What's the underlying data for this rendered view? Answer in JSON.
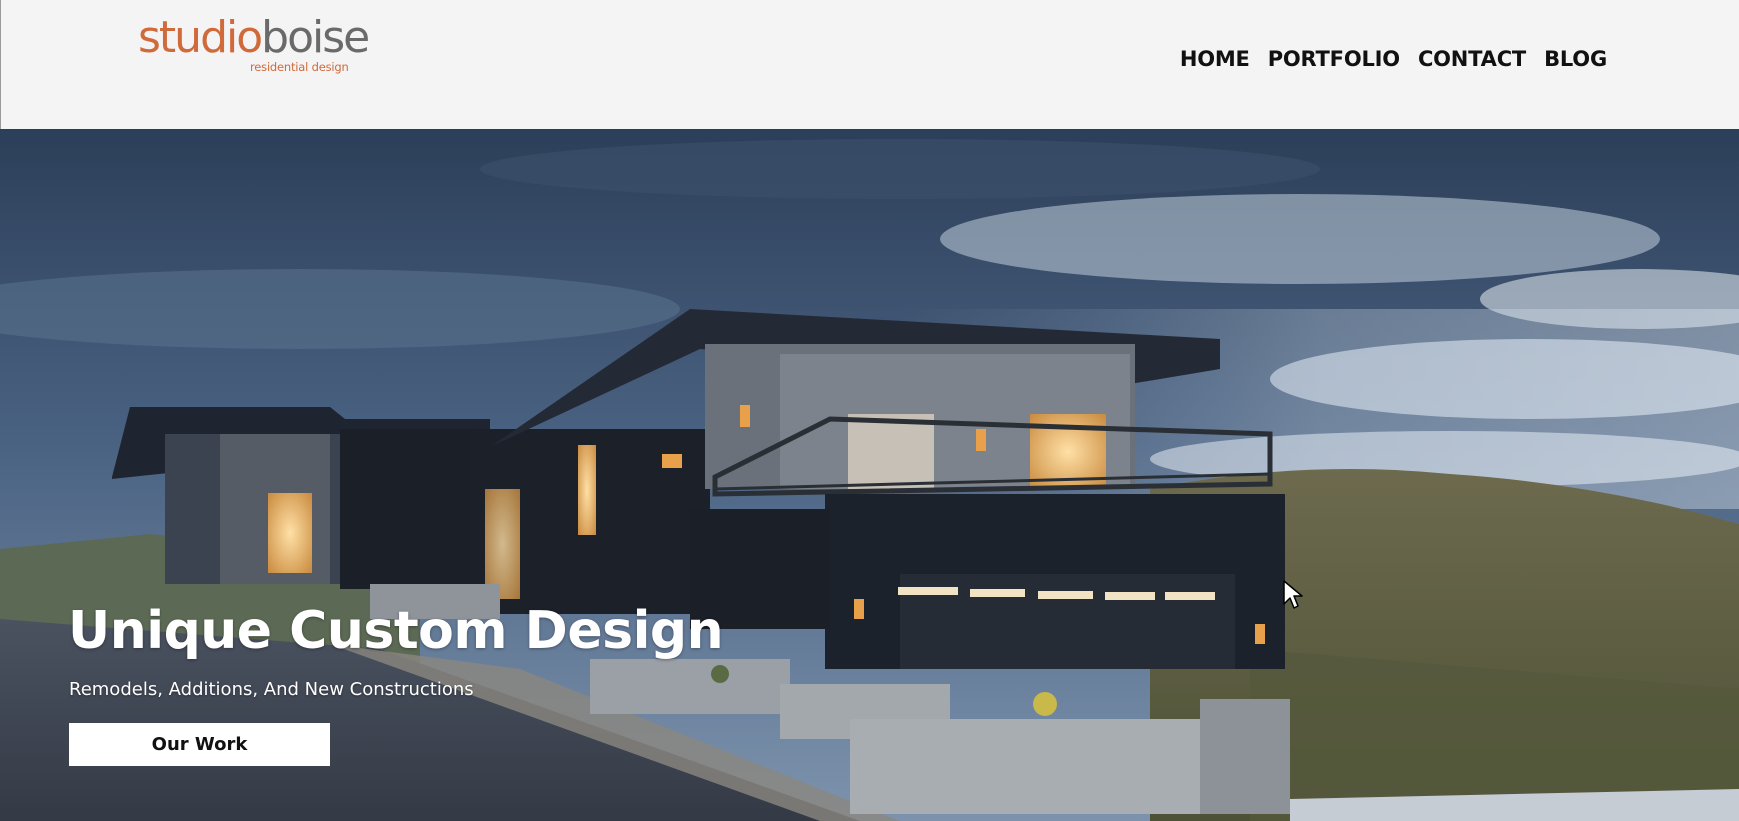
{
  "header": {
    "logo": {
      "word_part_a": "studio",
      "word_part_b": "boise",
      "tagline": "residential design"
    },
    "nav": [
      {
        "label": "HOME"
      },
      {
        "label": "PORTFOLIO"
      },
      {
        "label": "CONTACT"
      },
      {
        "label": "BLOG"
      }
    ]
  },
  "hero": {
    "title": "Unique Custom Design",
    "subtitle": "Remodels, Additions, And New Constructions",
    "cta_label": "Our Work",
    "image_subject": "modern house at dusk on hillside"
  },
  "colors": {
    "brand_orange": "#d06a3a",
    "logo_gray": "#6a6a6a",
    "header_bg": "#f4f4f4",
    "nav_text": "#111111",
    "hero_text": "#ffffff",
    "button_bg": "#ffffff"
  },
  "icons": {
    "cursor": "mouse-pointer-icon"
  }
}
